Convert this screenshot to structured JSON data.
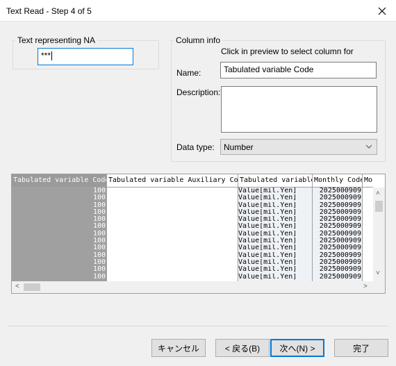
{
  "window": {
    "title": "Text Read - Step 4 of 5"
  },
  "na_group": {
    "label": "Text representing NA",
    "value": "***"
  },
  "column_info": {
    "label": "Column info",
    "hint": "Click in preview to select column for",
    "name_label": "Name:",
    "name_value": "Tabulated variable Code",
    "description_label": "Description:",
    "description_value": "",
    "datatype_label": "Data type:",
    "datatype_value": "Number"
  },
  "grid": {
    "headers": [
      "Tabulated variable Code",
      "Tabulated variable Auxiliary Code",
      "Tabulated variable",
      "Monthly Code",
      "Monthl"
    ],
    "columns": [
      [
        "100",
        "100",
        "100",
        "100",
        "100",
        "100",
        "100",
        "100",
        "100",
        "100",
        "100",
        "100",
        "100"
      ],
      [
        "",
        "",
        "",
        "",
        "",
        "",
        "",
        "",
        "",
        "",
        "",
        "",
        ""
      ],
      [
        "Value[mil.Yen]",
        "Value[mil.Yen]",
        "Value[mil.Yen]",
        "Value[mil.Yen]",
        "Value[mil.Yen]",
        "Value[mil.Yen]",
        "Value[mil.Yen]",
        "Value[mil.Yen]",
        "Value[mil.Yen]",
        "Value[mil.Yen]",
        "Value[mil.Yen]",
        "Value[mil.Yen]",
        "Value[mil.Yen]"
      ],
      [
        "2025000909",
        "2025000909",
        "2025000909",
        "2025000909",
        "2025000909",
        "2025000909",
        "2025000909",
        "2025000909",
        "2025000909",
        "2025000909",
        "2025000909",
        "2025000909",
        "2025000909"
      ],
      [
        "",
        "",
        "",
        "",
        "",
        "",
        "",
        "",
        "",
        "",
        "",
        "",
        ""
      ]
    ]
  },
  "buttons": {
    "cancel": "キャンセル",
    "back": "< 戻る(B)",
    "next": "次へ(N) >",
    "finish": "完了"
  }
}
